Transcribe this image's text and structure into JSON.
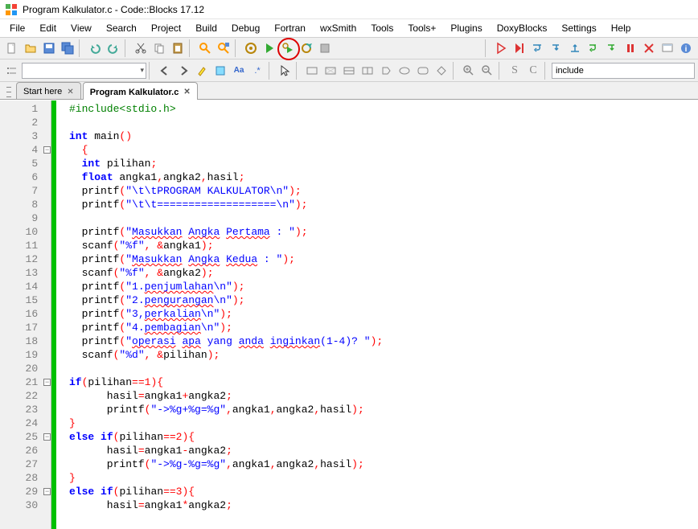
{
  "window": {
    "title": "Program Kalkulator.c - Code::Blocks 17.12"
  },
  "menu": {
    "items": [
      "File",
      "Edit",
      "View",
      "Search",
      "Project",
      "Build",
      "Debug",
      "Fortran",
      "wxSmith",
      "Tools",
      "Tools+",
      "Plugins",
      "DoxyBlocks",
      "Settings",
      "Help"
    ]
  },
  "toolbar2": {
    "include_hint": "include"
  },
  "tabs": {
    "items": [
      {
        "label": "Start here",
        "active": false
      },
      {
        "label": "Program Kalkulator.c",
        "active": true
      }
    ]
  },
  "code": {
    "lines": [
      {
        "n": 1,
        "html": "<span class='pp'>#include&lt;stdio.h&gt;</span>"
      },
      {
        "n": 2,
        "html": ""
      },
      {
        "n": 3,
        "html": "<span class='kw'>int</span> main<span class='op'>()</span>"
      },
      {
        "n": 4,
        "html": "<span class='op'>{</span>",
        "fold": true
      },
      {
        "n": 5,
        "html": "<span class='kw'>int</span> pilihan<span class='op'>;</span>"
      },
      {
        "n": 6,
        "html": "<span class='kw'>float</span> angka1<span class='op'>,</span>angka2<span class='op'>,</span>hasil<span class='op'>;</span>"
      },
      {
        "n": 7,
        "html": "printf<span class='op'>(</span><span class='str'>\"\\t\\tPROGRAM KALKULATOR\\n\"</span><span class='op'>);</span>"
      },
      {
        "n": 8,
        "html": "printf<span class='op'>(</span><span class='str'>\"\\t\\t===================\\n\"</span><span class='op'>);</span>"
      },
      {
        "n": 9,
        "html": ""
      },
      {
        "n": 10,
        "html": "printf<span class='op'>(</span><span class='str'>\"<span class='wavy'>Masukkan</span> <span class='wavy'>Angka</span> <span class='wavy'>Pertama</span> : \"</span><span class='op'>);</span>"
      },
      {
        "n": 11,
        "html": "scanf<span class='op'>(</span><span class='str'>\"%f\"</span><span class='op'>,</span> <span class='op'>&amp;</span>angka1<span class='op'>);</span>"
      },
      {
        "n": 12,
        "html": "printf<span class='op'>(</span><span class='str'>\"<span class='wavy'>Masukkan</span> <span class='wavy'>Angka</span> <span class='wavy'>Kedua</span> : \"</span><span class='op'>);</span>"
      },
      {
        "n": 13,
        "html": "scanf<span class='op'>(</span><span class='str'>\"%f\"</span><span class='op'>,</span> <span class='op'>&amp;</span>angka2<span class='op'>);</span>"
      },
      {
        "n": 14,
        "html": "printf<span class='op'>(</span><span class='str'>\"1.<span class='wavy'>penjumlahan</span>\\n\"</span><span class='op'>);</span>"
      },
      {
        "n": 15,
        "html": "printf<span class='op'>(</span><span class='str'>\"2.<span class='wavy'>pengurangan</span>\\n\"</span><span class='op'>);</span>"
      },
      {
        "n": 16,
        "html": "printf<span class='op'>(</span><span class='str'>\"3,<span class='wavy'>perkalian</span>\\n\"</span><span class='op'>);</span>"
      },
      {
        "n": 17,
        "html": "printf<span class='op'>(</span><span class='str'>\"4.<span class='wavy'>pembagian</span>\\n\"</span><span class='op'>);</span>"
      },
      {
        "n": 18,
        "html": "printf<span class='op'>(</span><span class='str'>\"<span class='wavy'>operasi</span> <span class='wavy'>apa</span> yang <span class='wavy'>anda</span> <span class='wavy'>inginkan</span>(1-4)? \"</span><span class='op'>);</span>"
      },
      {
        "n": 19,
        "html": "scanf<span class='op'>(</span><span class='str'>\"%d\"</span><span class='op'>,</span> <span class='op'>&amp;</span>pilihan<span class='op'>);</span>"
      },
      {
        "n": 20,
        "html": ""
      },
      {
        "n": 21,
        "html": "<span class='kw'>if</span><span class='op'>(</span>pilihan<span class='op'>==</span><span class='op'>1</span><span class='op'>){</span>",
        "fold": true,
        "indent": -1
      },
      {
        "n": 22,
        "html": "    hasil<span class='op'>=</span>angka1<span class='op'>+</span>angka2<span class='op'>;</span>"
      },
      {
        "n": 23,
        "html": "    printf<span class='op'>(</span><span class='str'>\"-&gt;%g+%g=%g\"</span><span class='op'>,</span>angka1<span class='op'>,</span>angka2<span class='op'>,</span>hasil<span class='op'>);</span>"
      },
      {
        "n": 24,
        "html": "<span class='op'>}</span>",
        "indent": -1
      },
      {
        "n": 25,
        "html": "<span class='kw'>else</span> <span class='kw'>if</span><span class='op'>(</span>pilihan<span class='op'>==</span><span class='op'>2</span><span class='op'>){</span>",
        "fold": true,
        "indent": -1
      },
      {
        "n": 26,
        "html": "    hasil<span class='op'>=</span>angka1<span class='op'>-</span>angka2<span class='op'>;</span>"
      },
      {
        "n": 27,
        "html": "    printf<span class='op'>(</span><span class='str'>\"-&gt;%g-%g=%g\"</span><span class='op'>,</span>angka1<span class='op'>,</span>angka2<span class='op'>,</span>hasil<span class='op'>);</span>"
      },
      {
        "n": 28,
        "html": "<span class='op'>}</span>",
        "indent": -1
      },
      {
        "n": 29,
        "html": "<span class='kw'>else</span> <span class='kw'>if</span><span class='op'>(</span>pilihan<span class='op'>==</span><span class='op'>3</span><span class='op'>){</span>",
        "fold": true,
        "indent": -1
      },
      {
        "n": 30,
        "html": "    hasil<span class='op'>=</span>angka1<span class='op'>*</span>angka2<span class='op'>;</span>"
      }
    ]
  }
}
